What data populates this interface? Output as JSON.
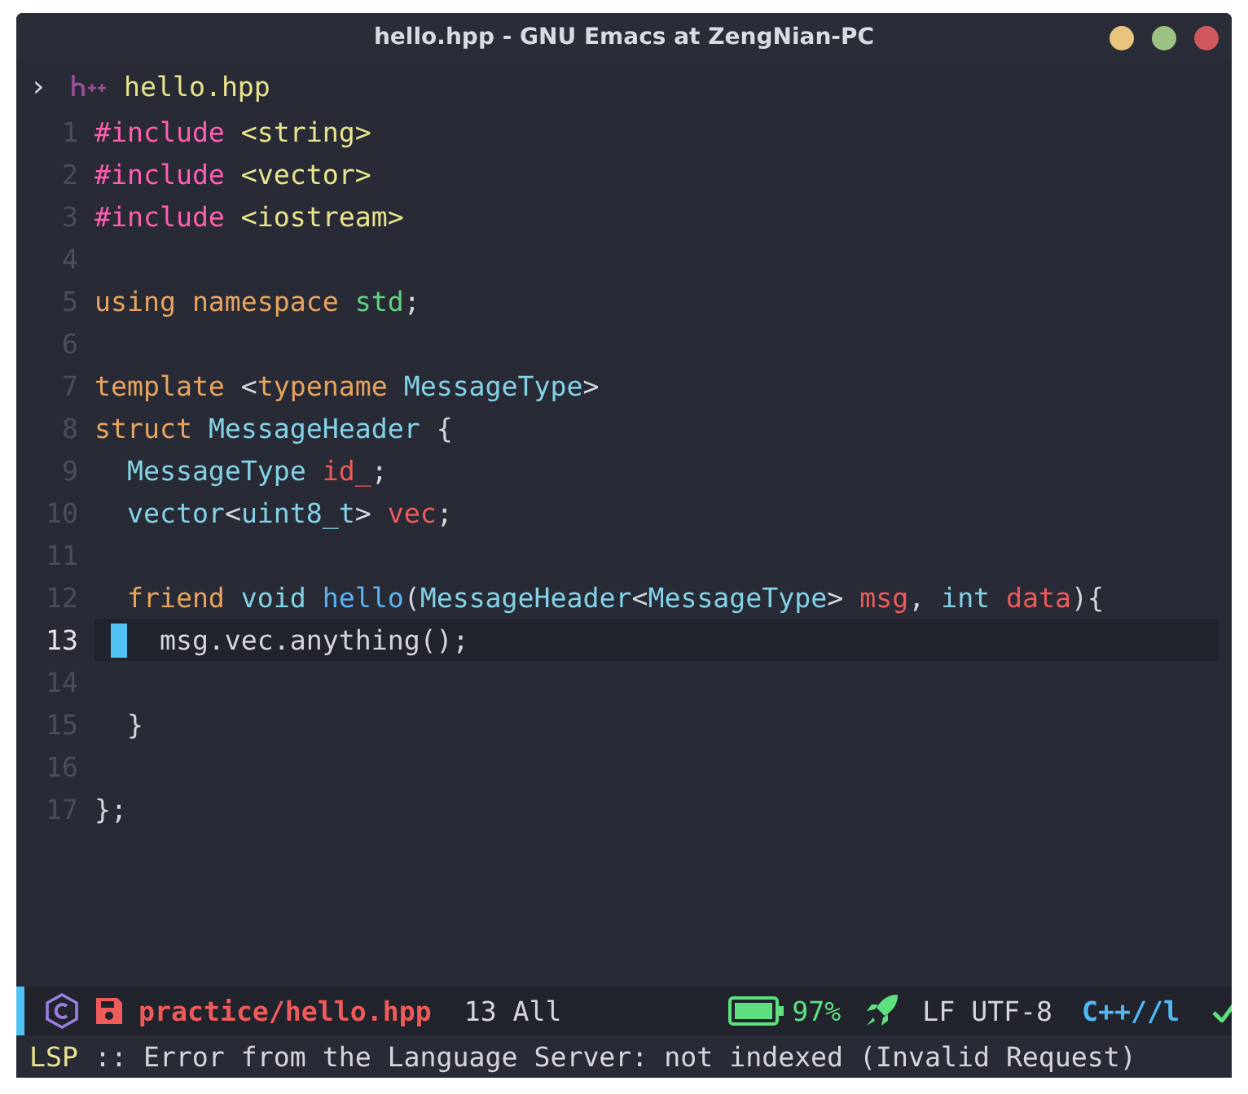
{
  "window": {
    "title": "hello.hpp - GNU Emacs at ZengNian-PC"
  },
  "header": {
    "chevron": "›",
    "filename": "hello.hpp"
  },
  "lines": [
    {
      "number": "1",
      "current": false,
      "tokens": [
        {
          "text": "#include",
          "kind": "preproc"
        },
        {
          "text": " <string>",
          "kind": "string"
        }
      ]
    },
    {
      "number": "2",
      "current": false,
      "tokens": [
        {
          "text": "#include",
          "kind": "preproc"
        },
        {
          "text": " <vector>",
          "kind": "string"
        }
      ]
    },
    {
      "number": "3",
      "current": false,
      "tokens": [
        {
          "text": "#include",
          "kind": "preproc"
        },
        {
          "text": " <iostream>",
          "kind": "string"
        }
      ]
    },
    {
      "number": "4",
      "current": false
    },
    {
      "number": "5",
      "current": false,
      "tokens": [
        {
          "text": "using namespace",
          "kind": "keyword"
        },
        {
          "text": " std",
          "kind": "namespace"
        },
        {
          "text": ";",
          "kind": "plain"
        }
      ]
    },
    {
      "number": "6",
      "current": false
    },
    {
      "number": "7",
      "current": false,
      "tokens": [
        {
          "text": "template",
          "kind": "keyword"
        },
        {
          "text": " <",
          "kind": "plain"
        },
        {
          "text": "typename",
          "kind": "keyword"
        },
        {
          "text": " MessageType",
          "kind": "type"
        },
        {
          "text": ">",
          "kind": "plain"
        }
      ]
    },
    {
      "number": "8",
      "current": false,
      "tokens": [
        {
          "text": "struct",
          "kind": "keyword"
        },
        {
          "text": " MessageHeader",
          "kind": "type"
        },
        {
          "text": " {",
          "kind": "plain"
        }
      ]
    },
    {
      "number": "9",
      "current": false,
      "tokens": [
        {
          "text": "  MessageType",
          "kind": "type"
        },
        {
          "text": " id_",
          "kind": "variable"
        },
        {
          "text": ";",
          "kind": "plain"
        }
      ]
    },
    {
      "number": "10",
      "current": false,
      "tokens": [
        {
          "text": "  vector",
          "kind": "type"
        },
        {
          "text": "<",
          "kind": "plain"
        },
        {
          "text": "uint8_t",
          "kind": "type"
        },
        {
          "text": "> ",
          "kind": "plain"
        },
        {
          "text": "vec",
          "kind": "variable"
        },
        {
          "text": ";",
          "kind": "plain"
        }
      ]
    },
    {
      "number": "11",
      "current": false
    },
    {
      "number": "12",
      "current": false,
      "tokens": [
        {
          "text": "  friend",
          "kind": "keyword"
        },
        {
          "text": " void",
          "kind": "type"
        },
        {
          "text": " hello",
          "kind": "function"
        },
        {
          "text": "(",
          "kind": "plain"
        },
        {
          "text": "MessageHeader",
          "kind": "type"
        },
        {
          "text": "<",
          "kind": "plain"
        },
        {
          "text": "MessageType",
          "kind": "type"
        },
        {
          "text": "> ",
          "kind": "plain"
        },
        {
          "text": "msg",
          "kind": "variable"
        },
        {
          "text": ", ",
          "kind": "plain"
        },
        {
          "text": "int",
          "kind": "type"
        },
        {
          "text": " data",
          "kind": "variable"
        },
        {
          "text": "){",
          "kind": "plain"
        }
      ]
    },
    {
      "number": "13",
      "current": true,
      "tokens": [
        {
          "text": "    msg.vec.anything();",
          "kind": "plain"
        }
      ]
    },
    {
      "number": "14",
      "current": false
    },
    {
      "number": "15",
      "current": false,
      "tokens": [
        {
          "text": "  }",
          "kind": "plain"
        }
      ]
    },
    {
      "number": "16",
      "current": false
    },
    {
      "number": "17",
      "current": false,
      "tokens": [
        {
          "text": "};",
          "kind": "plain"
        }
      ]
    }
  ],
  "mode_line": {
    "buffer": "practice/hello.hpp",
    "position": "13 All",
    "battery": "97%",
    "encoding": "LF UTF-8",
    "mode": "C++//l"
  },
  "echo_area": {
    "prefix": "LSP",
    "message": ":: Error from the Language Server: not indexed (Invalid Request)"
  }
}
